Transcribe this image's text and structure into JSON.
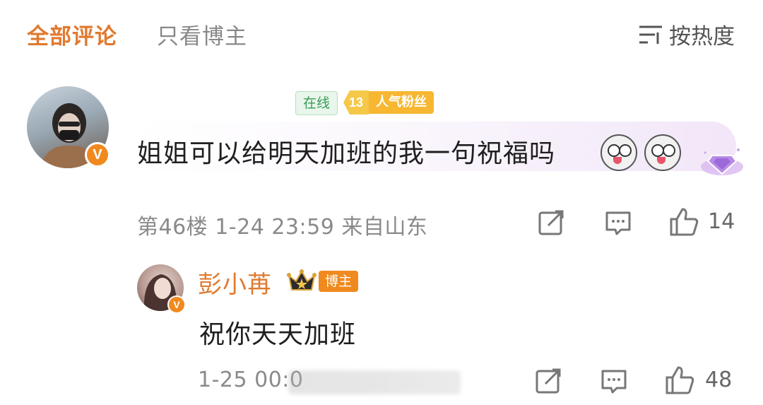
{
  "header": {
    "tab_all": "全部评论",
    "tab_owner_only": "只看博主",
    "sort_label": "按热度",
    "sort_icon": "sort-lines-icon"
  },
  "comment": {
    "verified_mark": "V",
    "online_badge": "在线",
    "fan_level": "13",
    "fan_label": "人气粉丝",
    "text": "姐姐可以给明天加班的我一句祝福吗",
    "emojis": [
      "husky-emoji",
      "husky-emoji"
    ],
    "meta": "第46楼 1-24 23:59 来自山东",
    "like_count": "14"
  },
  "reply": {
    "verified_mark": "V",
    "author": "彭小苒",
    "owner_tag": "博主",
    "text": "祝你天天加班",
    "meta": "1-25 00:0",
    "like_count": "48"
  },
  "colors": {
    "accent": "#e07a2f",
    "muted": "#8a8a8a",
    "verified": "#f08a1e",
    "online": "#3a9b57",
    "fan_badge": "#f7b731"
  }
}
